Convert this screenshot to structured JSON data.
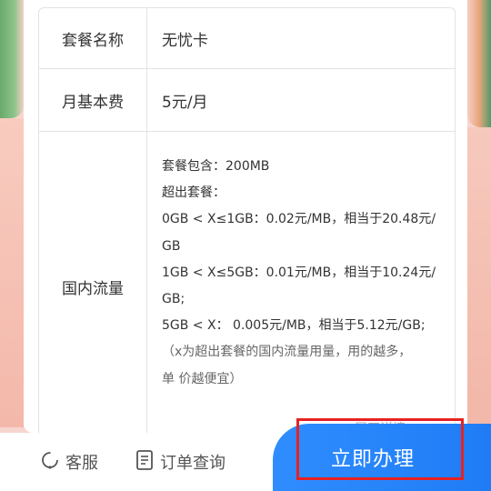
{
  "plan_table": {
    "rows": [
      {
        "label": "套餐名称",
        "value": "无忧卡"
      },
      {
        "label": "月基本费",
        "value": "5元/月"
      },
      {
        "label": "国内流量",
        "lines": [
          "套餐包含：200MB",
          "超出套餐：",
          "0GB < X≤1GB：0.02元/MB，相当于20.48元/",
          "GB",
          "1GB < X≤5GB：0.01元/MB，相当于10.24元/",
          "GB;",
          "5GB < X： 0.005元/MB，相当于5.12元/GB;",
          "（x为超出套餐的国内流量用量，用的越多，",
          "单 价越便宜）"
        ]
      }
    ],
    "more_text": "展开详情"
  },
  "bottom_bar": {
    "service_label": "客服",
    "order_query_label": "订单查询",
    "apply_label": "立即办理"
  },
  "colors": {
    "accent": "#1f7cf5",
    "highlight_border": "#e62222"
  }
}
